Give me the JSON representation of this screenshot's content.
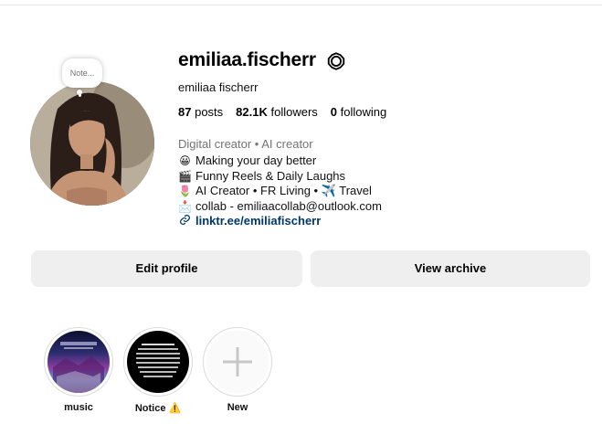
{
  "profile": {
    "username": "emiliaa.fischerr",
    "fullname": "emiliaa fischerr",
    "note_placeholder": "Note...",
    "stats": {
      "posts_count": "87",
      "posts_label": "posts",
      "followers_count": "82.1K",
      "followers_label": "followers",
      "following_count": "0",
      "following_label": "following"
    },
    "category": "Digital creator • AI creator",
    "bio": [
      {
        "icon": "grinning-face-emoji",
        "glyph": "😀",
        "text": "Making your day better"
      },
      {
        "icon": "clapper-board-emoji",
        "glyph": "🎬",
        "text": "Funny Reels & Daily Laughs"
      },
      {
        "icon": "tulip-emoji",
        "glyph": "🌷",
        "text": "AI Creator • FR Living • ✈️ Travel"
      },
      {
        "icon": "envelope-emoji",
        "glyph": "📩",
        "text": "collab - emiliaacollab@outlook.com"
      }
    ],
    "link": "linktr.ee/emiliafischerr"
  },
  "actions": {
    "edit_label": "Edit profile",
    "archive_label": "View archive"
  },
  "highlights": [
    {
      "label": "music"
    },
    {
      "label": "Notice"
    },
    {
      "label": "New"
    }
  ],
  "colors": {
    "button_bg": "#efefef",
    "secondary_text": "#737373",
    "link": "#00376b"
  }
}
